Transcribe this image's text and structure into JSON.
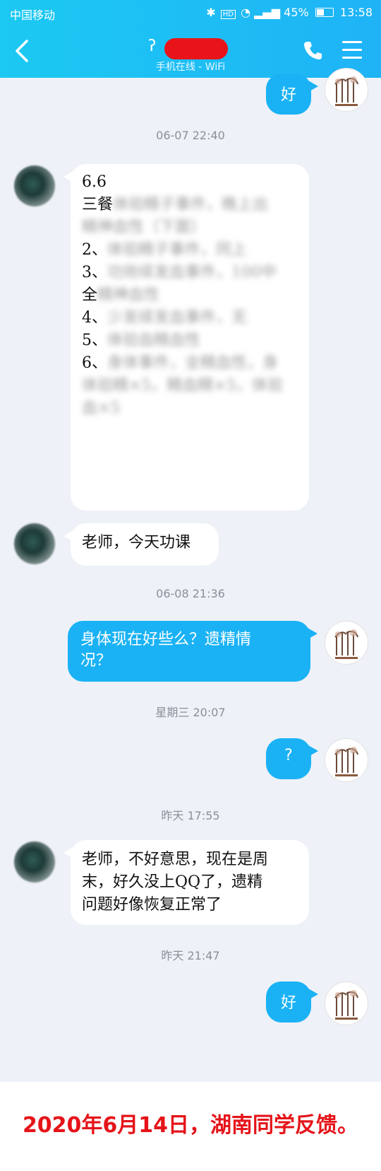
{
  "status_bar": {
    "carrier": "中国移动",
    "battery": "45%",
    "time": "13:58"
  },
  "header": {
    "subtitle": "手机在线 - WiFi",
    "back_icon": "chevron-left-icon",
    "call_icon": "phone-icon",
    "menu_icon": "menu-icon"
  },
  "messages": {
    "m0": {
      "sender": "self",
      "text": "好"
    },
    "t1": "06-07 22:40",
    "m1": {
      "sender": "other",
      "lines": [
        "6.6",
        "三餐",
        "2、",
        "3、",
        "全",
        "4、",
        "5、",
        "6、"
      ]
    },
    "m2": {
      "sender": "other",
      "text": "老师，今天功课"
    },
    "t2": "06-08 21:36",
    "m3": {
      "sender": "self",
      "line1": "身体现在好些么？遗精情",
      "line2": "况？"
    },
    "t3": "星期三 20:07",
    "m4": {
      "sender": "self",
      "text": "?"
    },
    "t4": "昨天 17:55",
    "m5": {
      "sender": "other",
      "line1": "老师，不好意思，现在是周",
      "line2": "末，好久没上QQ了，遗精",
      "line3": "问题好像恢复正常了"
    },
    "t5": "昨天 21:47",
    "m6": {
      "sender": "self",
      "text": "好"
    }
  },
  "footer": {
    "caption": "2020年6月14日，湖南同学反馈。"
  },
  "colors": {
    "header_bg": "#1cc9f2",
    "self_bubble": "#1ab2f5",
    "chat_bg": "#eef1f7",
    "caption": "#e5141a"
  }
}
